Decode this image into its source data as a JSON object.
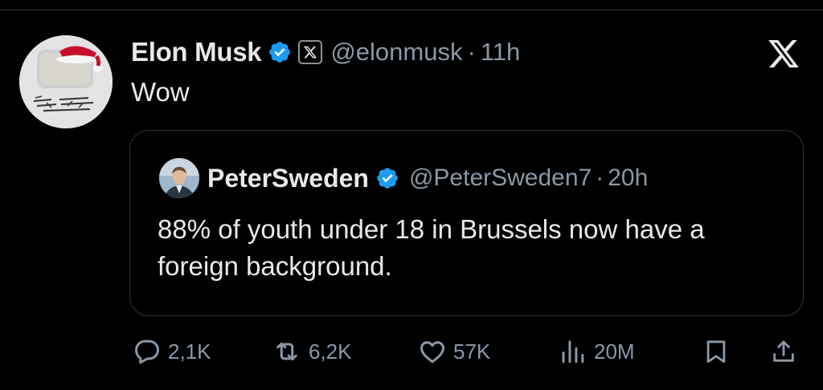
{
  "tweet": {
    "author": {
      "display_name": "Elon Musk",
      "handle": "@elonmusk",
      "time": "11h",
      "separator": "·",
      "verified_color": "#1d9bf0"
    },
    "text": "Wow",
    "platform_icon": "x-logo-icon"
  },
  "quoted_tweet": {
    "author": {
      "display_name": "PeterSweden",
      "handle": "@PeterSweden7",
      "time": "20h",
      "separator": "·"
    },
    "text": "88% of youth under 18 in Brussels now have a foreign background."
  },
  "actions": {
    "replies": "2,1K",
    "reposts": "6,2K",
    "likes": "57K",
    "views": "20M"
  },
  "colors": {
    "background": "#000000",
    "text": "#e7e9ea",
    "secondary": "#8b98a5",
    "border": "#2f3336",
    "verified": "#1d9bf0"
  }
}
